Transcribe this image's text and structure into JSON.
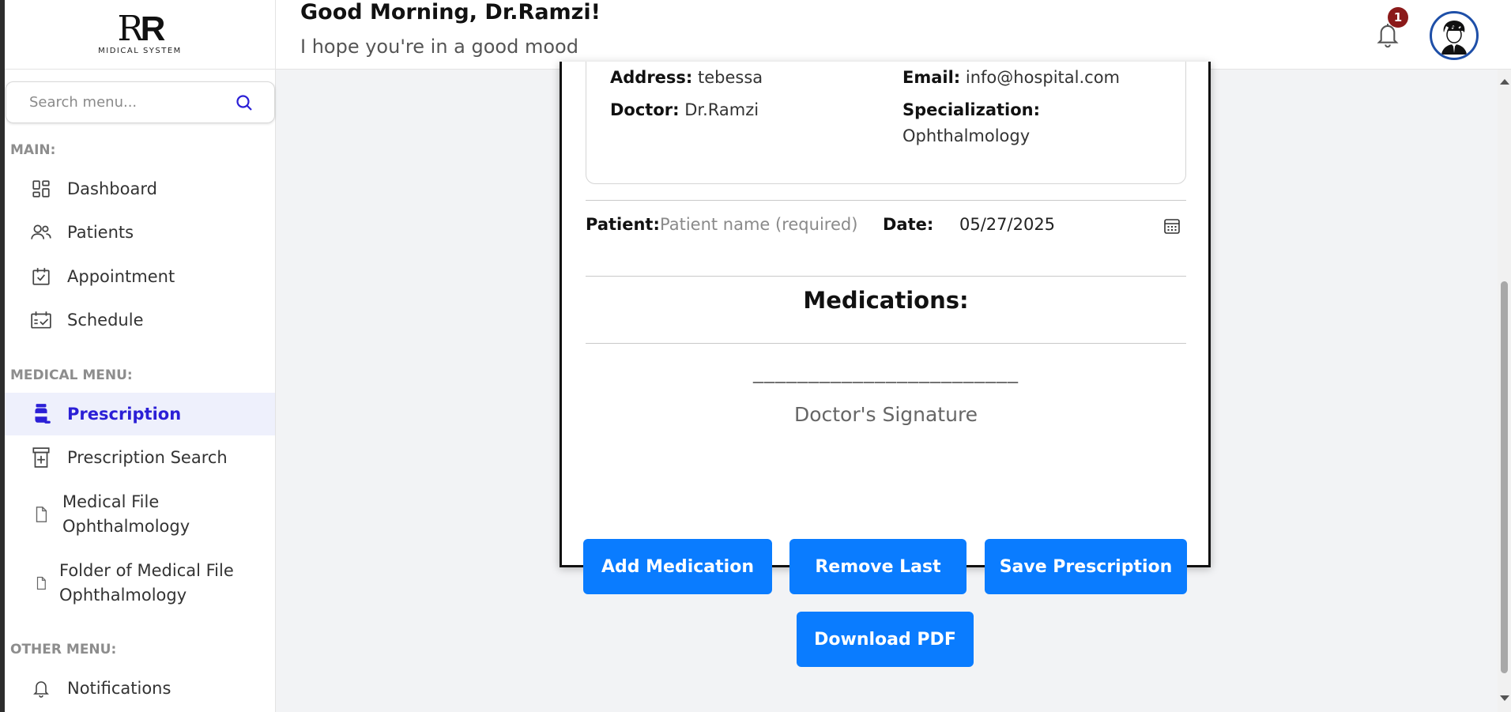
{
  "brand": {
    "logo_mark_light": "R",
    "logo_mark_bold": "R",
    "logo_text": "MIDICAL SYSTEM"
  },
  "header": {
    "greeting": "Good Morning, Dr.Ramzi!",
    "subtitle": "I hope you're in a good mood",
    "notification_count": "1"
  },
  "sidebar": {
    "search_placeholder": "Search menu...",
    "sections": {
      "main": "MAIN:",
      "medical": "MEDICAL MENU:",
      "other": "OTHER MENU:"
    },
    "items": {
      "dashboard": "Dashboard",
      "patients": "Patients",
      "appointment": "Appointment",
      "schedule": "Schedule",
      "prescription": "Prescription",
      "prescription_search": "Prescription Search",
      "medical_file_line1": "Medical File",
      "medical_file_line2": "Ophthalmology",
      "folder_line1": "Folder of Medical File",
      "folder_line2": "Ophthalmology",
      "notifications": "Notifications"
    },
    "active": "prescription"
  },
  "prescription": {
    "address_label": "Address:",
    "address_value": "tebessa",
    "email_label": "Email:",
    "email_value": "info@hospital.com",
    "doctor_label": "Doctor:",
    "doctor_value": "Dr.Ramzi",
    "specialization_label": "Specialization:",
    "specialization_value": "Ophthalmology",
    "patient_label": "Patient:",
    "patient_placeholder": "Patient name (required)",
    "patient_value": "",
    "date_label": "Date:",
    "date_value": "05/27/2025",
    "medications_title": "Medications:",
    "signature_line": "________________________",
    "signature_label": "Doctor's Signature"
  },
  "actions": {
    "add_medication": "Add Medication",
    "remove_last": "Remove Last",
    "save_prescription": "Save Prescription",
    "download_pdf": "Download PDF"
  },
  "colors": {
    "primary_button": "#0a7cff",
    "active_nav_text": "#2b1fd6",
    "active_nav_bg": "#eef0fc",
    "badge": "#8b1a1a",
    "avatar_border": "#1e4fa8"
  }
}
